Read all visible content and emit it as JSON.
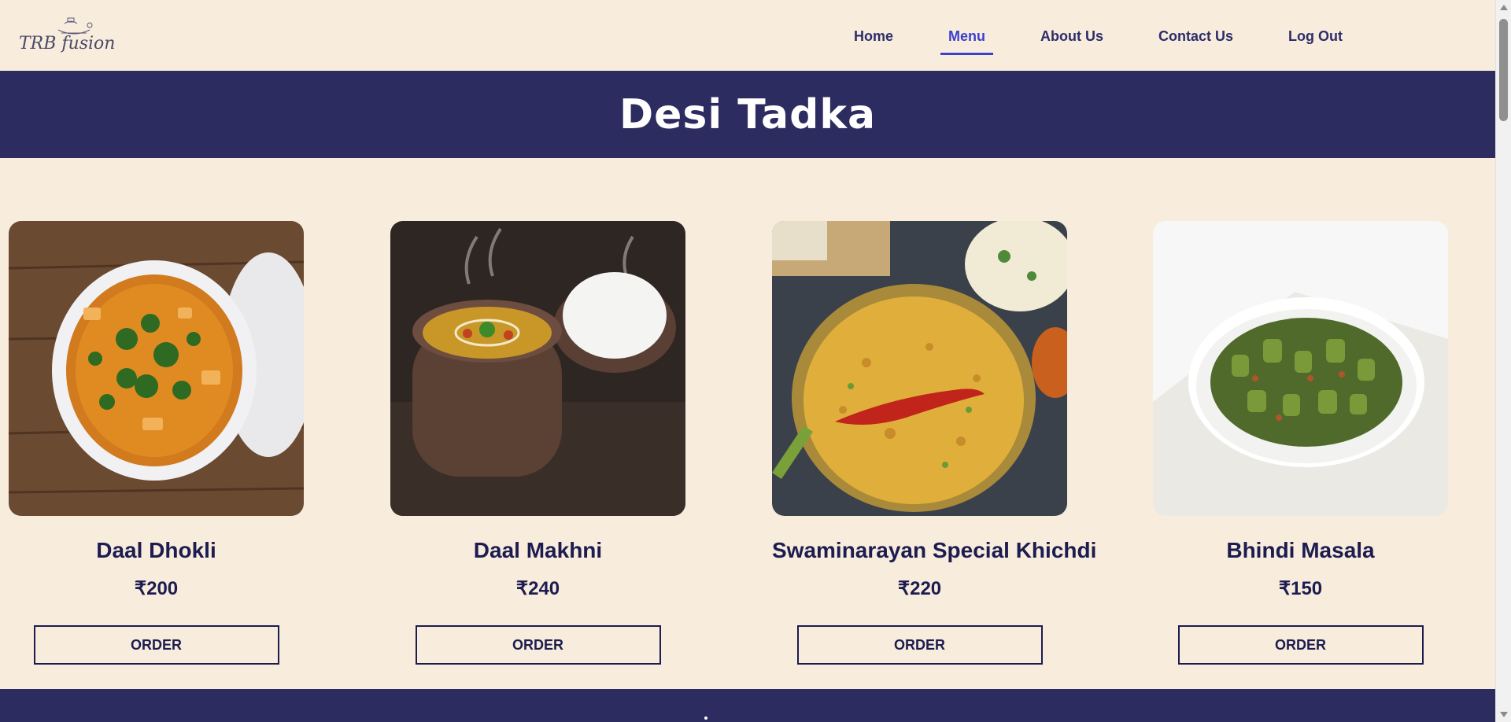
{
  "nav": {
    "logo_text": "TRB fusion",
    "links": [
      {
        "label": "Home",
        "active": false
      },
      {
        "label": "Menu",
        "active": true
      },
      {
        "label": "About Us",
        "active": false
      },
      {
        "label": "Contact Us",
        "active": false
      },
      {
        "label": "Log Out",
        "active": false
      }
    ]
  },
  "banner": {
    "title": "Desi Tadka"
  },
  "menu": {
    "items": [
      {
        "name": "Daal Dhokli",
        "price": "₹200",
        "button": "ORDER",
        "image": "daal-dhokli-photo"
      },
      {
        "name": "Daal Makhni",
        "price": "₹240",
        "button": "ORDER",
        "image": "daal-makhni-photo"
      },
      {
        "name": "Swaminarayan Special Khichdi",
        "price": "₹220",
        "button": "ORDER",
        "image": "khichdi-photo"
      },
      {
        "name": "Bhindi Masala",
        "price": "₹150",
        "button": "ORDER",
        "image": "bhindi-masala-photo"
      }
    ]
  },
  "colors": {
    "background": "#f8ecdc",
    "banner": "#2d2c60",
    "text_dark": "#1c1c50",
    "nav_active": "#3c3fd0"
  }
}
